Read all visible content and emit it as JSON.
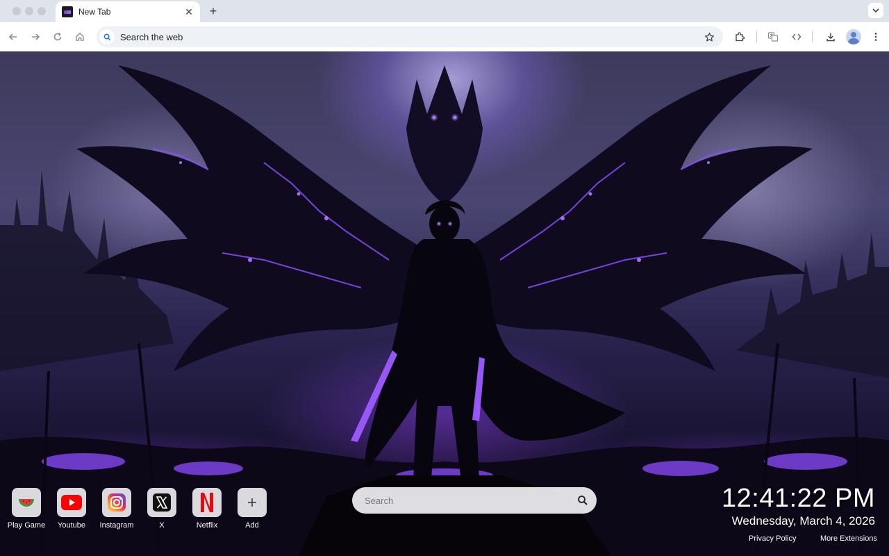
{
  "tab": {
    "title": "New Tab"
  },
  "omnibox": {
    "text": "Search the web"
  },
  "shortcuts": [
    {
      "label": "Play Game",
      "icon": "watermelon-icon"
    },
    {
      "label": "Youtube",
      "icon": "youtube-icon"
    },
    {
      "label": "Instagram",
      "icon": "instagram-icon"
    },
    {
      "label": "X",
      "icon": "x-logo-icon"
    },
    {
      "label": "Netflix",
      "icon": "netflix-icon"
    },
    {
      "label": "Add",
      "icon": "plus-icon"
    }
  ],
  "search": {
    "placeholder": "Search"
  },
  "clock": {
    "time": "12:41:22 PM",
    "date": "Wednesday, March 4, 2026"
  },
  "footer": {
    "privacy": "Privacy Policy",
    "more": "More Extensions"
  },
  "colors": {
    "accent_purple": "#7a3cff",
    "youtube_red": "#ff0000",
    "netflix_red": "#e50914"
  }
}
